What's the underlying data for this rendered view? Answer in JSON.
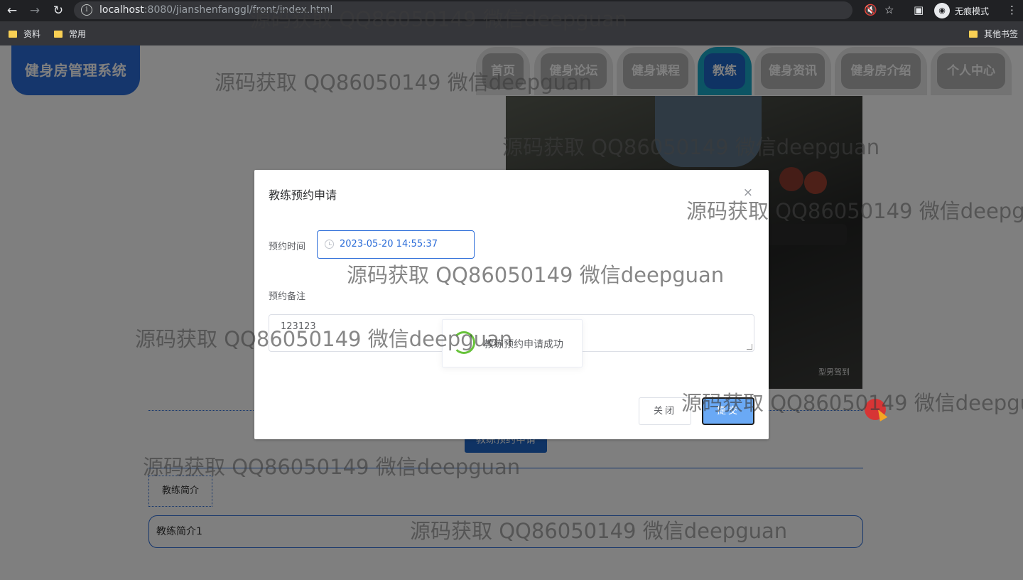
{
  "browser": {
    "url_host": "localhost",
    "url_rest": ":8080/jianshenfanggl/front/index.html",
    "incognito_label": "无痕模式",
    "bookmarks": [
      "资料",
      "常用"
    ],
    "other_bookmarks": "其他书签"
  },
  "app": {
    "logo": "健身房管理系统",
    "nav": [
      "首页",
      "健身论坛",
      "健身课程",
      "教练",
      "健身资讯",
      "健身房介绍",
      "个人中心"
    ],
    "active_nav": "教练"
  },
  "page": {
    "photo_credit": "型男驾到",
    "book_button": "教练预约申请",
    "intro_label": "教练简介",
    "intro_text": "教练简介1"
  },
  "dialog": {
    "title": "教练预约申请",
    "close_icon": "×",
    "time_label": "预约时间",
    "time_value": "2023-05-20 14:55:37",
    "remark_label": "预约备注",
    "remark_value": "123123",
    "toast": "教练预约申请成功",
    "cancel_button": "关闭",
    "submit_button": "提交"
  },
  "watermark": "源码获取 QQ86050149 微信deepguan",
  "colors": {
    "primary": "#2b6cd8",
    "active_tab_outer": "#18a8c8",
    "submit_bg": "#6aa9f5",
    "success": "#67c23a"
  }
}
